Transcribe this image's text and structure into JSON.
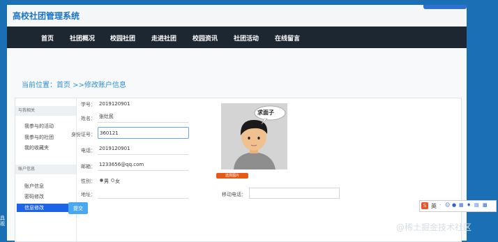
{
  "header": {
    "site_title": "高校社团管理系统"
  },
  "nav": {
    "items": [
      {
        "label": "首页"
      },
      {
        "label": "社团概况"
      },
      {
        "label": "校园社团"
      },
      {
        "label": "走进社团"
      },
      {
        "label": "校园资讯"
      },
      {
        "label": "社团活动"
      },
      {
        "label": "在线留言"
      }
    ]
  },
  "breadcrumb": {
    "prefix": "当前位置：",
    "home": "首页",
    "separator": " >>",
    "current": "修改账户信息"
  },
  "sidebar": {
    "section1_title": "与我相关",
    "section1_items": [
      {
        "label": "我参与的活动"
      },
      {
        "label": "我参与的社团"
      },
      {
        "label": "我的收藏夹"
      }
    ],
    "section2_title": "账户信息",
    "section2_items": [
      {
        "label": "账户信息"
      },
      {
        "label": "密码修改"
      },
      {
        "label": "信息修改"
      }
    ]
  },
  "form": {
    "student_id": {
      "label": "学号：",
      "value": "2019120901"
    },
    "name": {
      "label": "姓名：",
      "value": "张灶民"
    },
    "id_card": {
      "label": "身份证号：",
      "value": "360121"
    },
    "phone": {
      "label": "电话：",
      "value": "2019120901"
    },
    "email": {
      "label": "邮箱：",
      "value": "1233656@qq.com"
    },
    "gender": {
      "label": "性别：",
      "male": "男",
      "female": "女",
      "selected": "male"
    },
    "address": {
      "label": "地址：",
      "value": ""
    },
    "remark": {
      "label": "移动电话：",
      "value": ""
    },
    "submit_label": "提交"
  },
  "avatar": {
    "speech": "求面子",
    "caption": "选择图片"
  },
  "ime": {
    "label": "英"
  },
  "left_strip": {
    "text": "具 视"
  },
  "watermark": "@稀土掘金技术社区"
}
